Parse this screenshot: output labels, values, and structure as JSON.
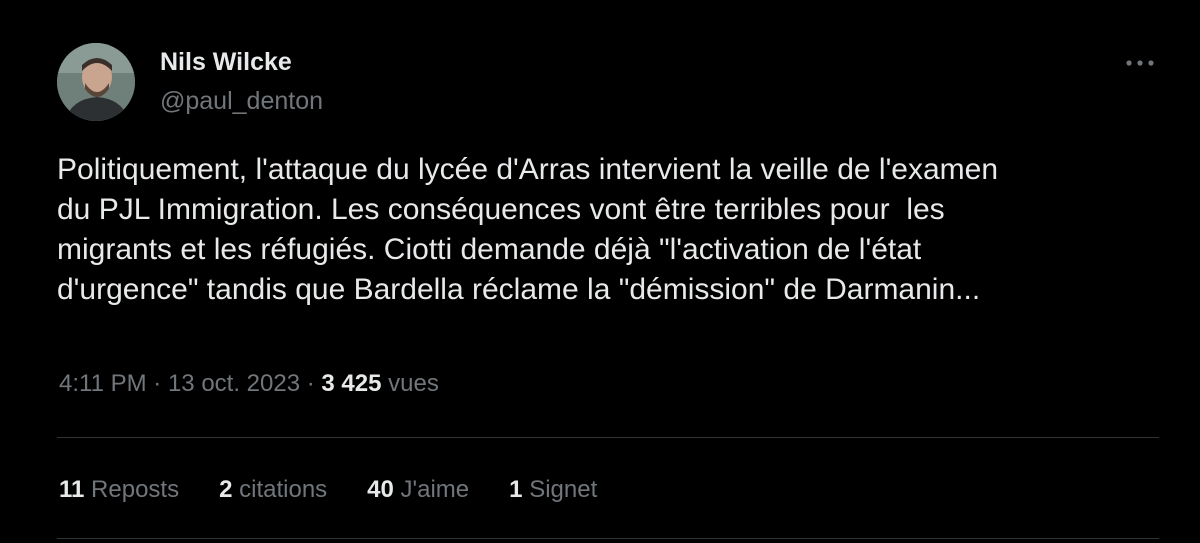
{
  "author": {
    "display_name": "Nils Wilcke",
    "handle": "@paul_denton"
  },
  "menu": {
    "icon": "more-horizontal-icon"
  },
  "tweet": {
    "lines": [
      "Politiquement, l'attaque du lycée d'Arras intervient la veille de l'examen",
      "du PJL Immigration. Les conséquences vont être terribles pour  les",
      "migrants et les réfugiés. Ciotti demande déjà \"l'activation de l'état",
      "d'urgence\" tandis que Bardella réclame la \"démission\" de Darmanin..."
    ]
  },
  "meta": {
    "time": "4:11 PM",
    "separator": "·",
    "date": "13 oct. 2023",
    "views_count": "3 425",
    "views_label": "vues"
  },
  "stats": [
    {
      "count": "11",
      "label": "Reposts"
    },
    {
      "count": "2",
      "label": "citations"
    },
    {
      "count": "40",
      "label": "J'aime"
    },
    {
      "count": "1",
      "label": "Signet"
    }
  ],
  "colors": {
    "background": "#000000",
    "text_primary": "#e7e9ea",
    "text_secondary": "#71767b",
    "divider": "#2f3336"
  }
}
